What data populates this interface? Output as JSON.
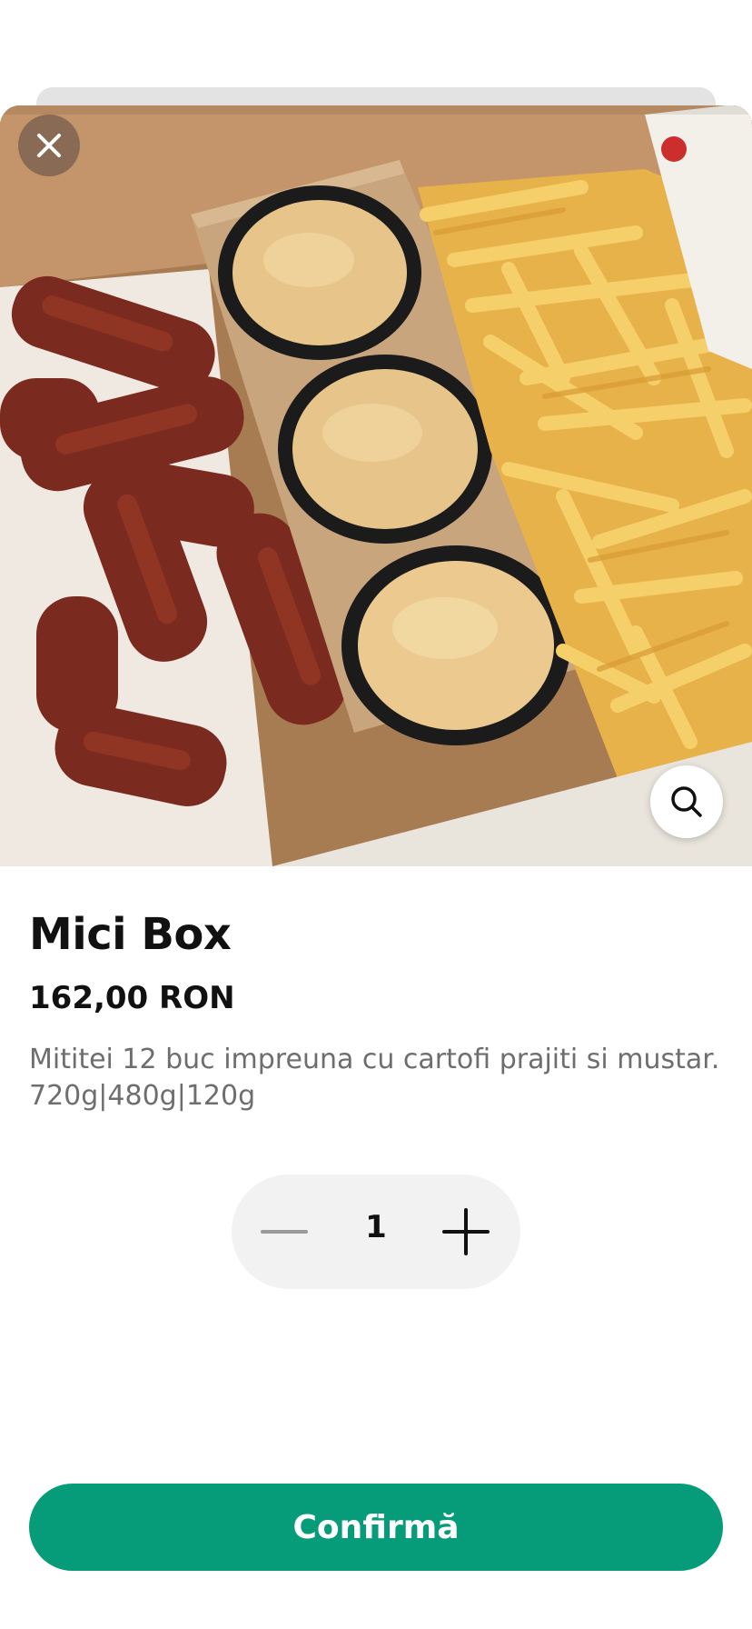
{
  "product": {
    "title": "Mici Box",
    "price": "162,00 RON",
    "description_lines": [
      "Mititei 12 buc impreuna cu cartofi prajiti si mustar.",
      "720g|480g|120g"
    ]
  },
  "image": {
    "alt": "Mici Box"
  },
  "quantity": {
    "value": "1"
  },
  "actions": {
    "confirm_label": "Confirmă"
  },
  "icons": {
    "close": "close-icon",
    "zoom": "search-icon",
    "minus": "minus-icon",
    "plus": "plus-icon"
  },
  "colors": {
    "accent": "#069c7a",
    "title_text": "#111111",
    "description_text": "#6e6e6e",
    "stepper_background": "#f2f2f2"
  }
}
